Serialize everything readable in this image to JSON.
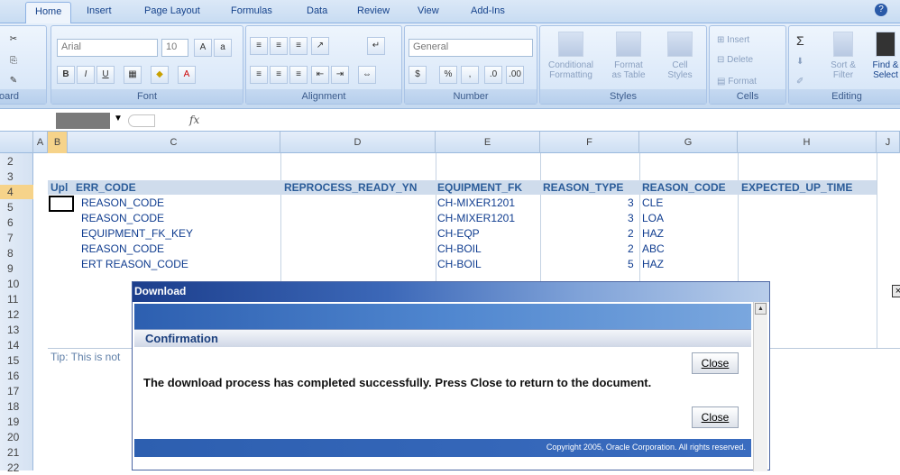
{
  "ribbon_tabs": [
    "Home",
    "Insert",
    "Page Layout",
    "Formulas",
    "Data",
    "Review",
    "View",
    "Add-Ins"
  ],
  "font": {
    "name": "Arial",
    "size": "10",
    "bold": "B",
    "italic": "I",
    "underline": "U",
    "label": "Font"
  },
  "alignment": {
    "label": "Alignment"
  },
  "number": {
    "format": "General",
    "currency": "$",
    "percent": "%",
    "comma": ",",
    "label": "Number"
  },
  "styles": {
    "conditional": "Conditional\nFormatting",
    "format_table": "Format\nas Table",
    "cell_styles": "Cell\nStyles",
    "label": "Styles"
  },
  "cells": {
    "insert": "Insert",
    "delete": "Delete",
    "format": "Format",
    "label": "Cells"
  },
  "editing": {
    "sum": "Σ",
    "sort": "Sort &\nFilter",
    "find": "Find &\nSelect",
    "label": "Editing"
  },
  "clipboard": {
    "label": "oard"
  },
  "formula_bar": {
    "fx": "fx",
    "value": ""
  },
  "columns": [
    "A",
    "B",
    "C",
    "D",
    "E",
    "F",
    "G",
    "H",
    "J"
  ],
  "rows": [
    "2",
    "3",
    "4",
    "5",
    "6",
    "7",
    "8",
    "9",
    "10",
    "11",
    "12",
    "13",
    "14",
    "15",
    "16",
    "17",
    "18",
    "19",
    "20",
    "21",
    "22"
  ],
  "table_headers": [
    "Upl",
    "ERR_CODE",
    "REPROCESS_READY_YN",
    "EQUIPMENT_FK",
    "REASON_TYPE",
    "REASON_CODE",
    "EXPECTED_UP_TIME"
  ],
  "table_rows": [
    {
      "err": "REASON_CODE",
      "equip": "CH-MIXER1201",
      "type": "3",
      "code": "CLE"
    },
    {
      "err": "REASON_CODE",
      "equip": "CH-MIXER1201",
      "type": "3",
      "code": "LOA"
    },
    {
      "err": "EQUIPMENT_FK_KEY",
      "equip": "CH-EQP",
      "type": "2",
      "code": "HAZ"
    },
    {
      "err": "REASON_CODE",
      "equip": "CH-BOIL",
      "type": "2",
      "code": "ABC"
    },
    {
      "err": "ERT REASON_CODE",
      "equip": "CH-BOIL",
      "type": "5",
      "code": "HAZ"
    }
  ],
  "tip": "Tip: This is not",
  "dialog": {
    "title": "Download",
    "close_x": "×",
    "section": "Confirmation",
    "close_label": "Close",
    "message": "The download process has completed successfully. Press Close to return to the document.",
    "copyright": "Copyright 2005, Oracle Corporation. All rights reserved."
  },
  "colors": {
    "ribbon": "#c5d9f0",
    "dialog_title": "#1c3e8c",
    "accent": "#2d5fb0"
  }
}
